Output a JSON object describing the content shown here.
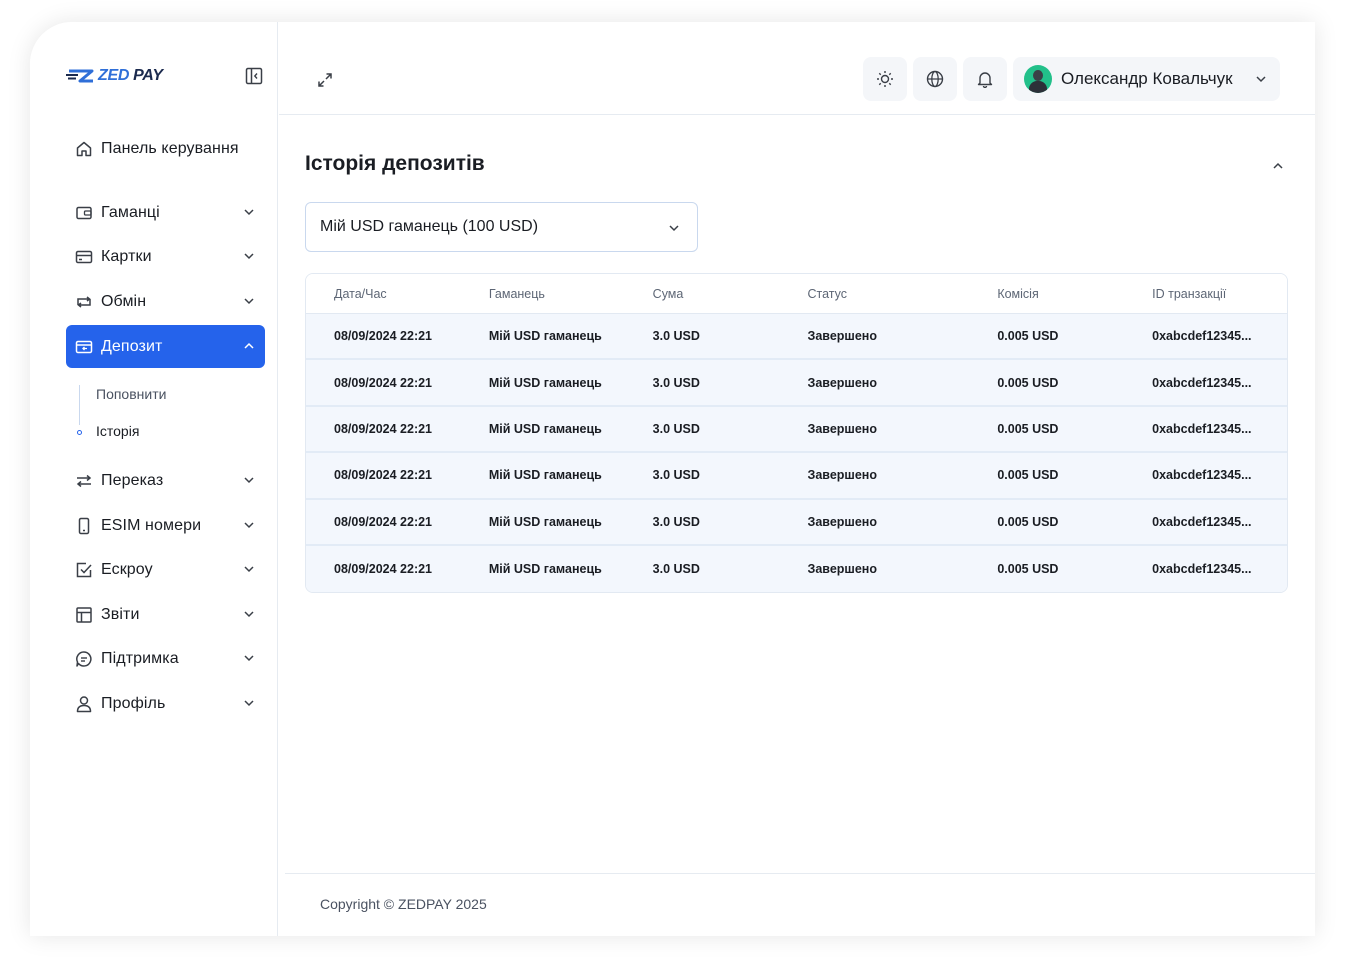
{
  "brand": {
    "name_part1": "ZED",
    "name_part2": "PAY"
  },
  "sidebar": {
    "items": [
      {
        "label": "Панель керування",
        "icon": "home-icon",
        "has_chevron": false
      },
      {
        "label": "Гаманці",
        "icon": "wallet-icon",
        "has_chevron": true
      },
      {
        "label": "Картки",
        "icon": "card-icon",
        "has_chevron": true
      },
      {
        "label": "Обмін",
        "icon": "exchange-icon",
        "has_chevron": true
      },
      {
        "label": "Депозит",
        "icon": "deposit-icon",
        "has_chevron": true,
        "active": true
      },
      {
        "label": "Переказ",
        "icon": "transfer-icon",
        "has_chevron": true
      },
      {
        "label": "ESIM номери",
        "icon": "sim-icon",
        "has_chevron": true
      },
      {
        "label": "Ескроу",
        "icon": "check-square-icon",
        "has_chevron": true
      },
      {
        "label": "Звіти",
        "icon": "table-icon",
        "has_chevron": true
      },
      {
        "label": "Підтримка",
        "icon": "chat-icon",
        "has_chevron": true
      },
      {
        "label": "Профіль",
        "icon": "user-icon",
        "has_chevron": true
      }
    ],
    "deposit_submenu": [
      {
        "label": "Поповнити"
      },
      {
        "label": "Історія",
        "active": true
      }
    ]
  },
  "header": {
    "user_name": "Олександр Ковальчук"
  },
  "main": {
    "title": "Історія депозитів",
    "wallet_select_value": "Мій USD гаманець (100 USD)",
    "table": {
      "columns": [
        "Дата/Час",
        "Гаманець",
        "Сума",
        "Статус",
        "Комісія",
        "ID транзакції"
      ],
      "rows": [
        [
          "08/09/2024 22:21",
          "Мій USD гаманець",
          "3.0 USD",
          "Завершено",
          "0.005 USD",
          "0xabcdef12345..."
        ],
        [
          "08/09/2024 22:21",
          "Мій USD гаманець",
          "3.0 USD",
          "Завершено",
          "0.005 USD",
          "0xabcdef12345..."
        ],
        [
          "08/09/2024 22:21",
          "Мій USD гаманець",
          "3.0 USD",
          "Завершено",
          "0.005 USD",
          "0xabcdef12345..."
        ],
        [
          "08/09/2024 22:21",
          "Мій USD гаманець",
          "3.0 USD",
          "Завершено",
          "0.005 USD",
          "0xabcdef12345..."
        ],
        [
          "08/09/2024 22:21",
          "Мій USD гаманець",
          "3.0 USD",
          "Завершено",
          "0.005 USD",
          "0xabcdef12345..."
        ],
        [
          "08/09/2024 22:21",
          "Мій USD гаманець",
          "3.0 USD",
          "Завершено",
          "0.005 USD",
          "0xabcdef12345..."
        ]
      ]
    }
  },
  "footer": {
    "copyright": "Copyright © ZEDPAY 2025"
  },
  "colors": {
    "accent": "#2563eb",
    "brand_blue": "#2f6fd8",
    "brand_dark": "#1b2a4e"
  }
}
